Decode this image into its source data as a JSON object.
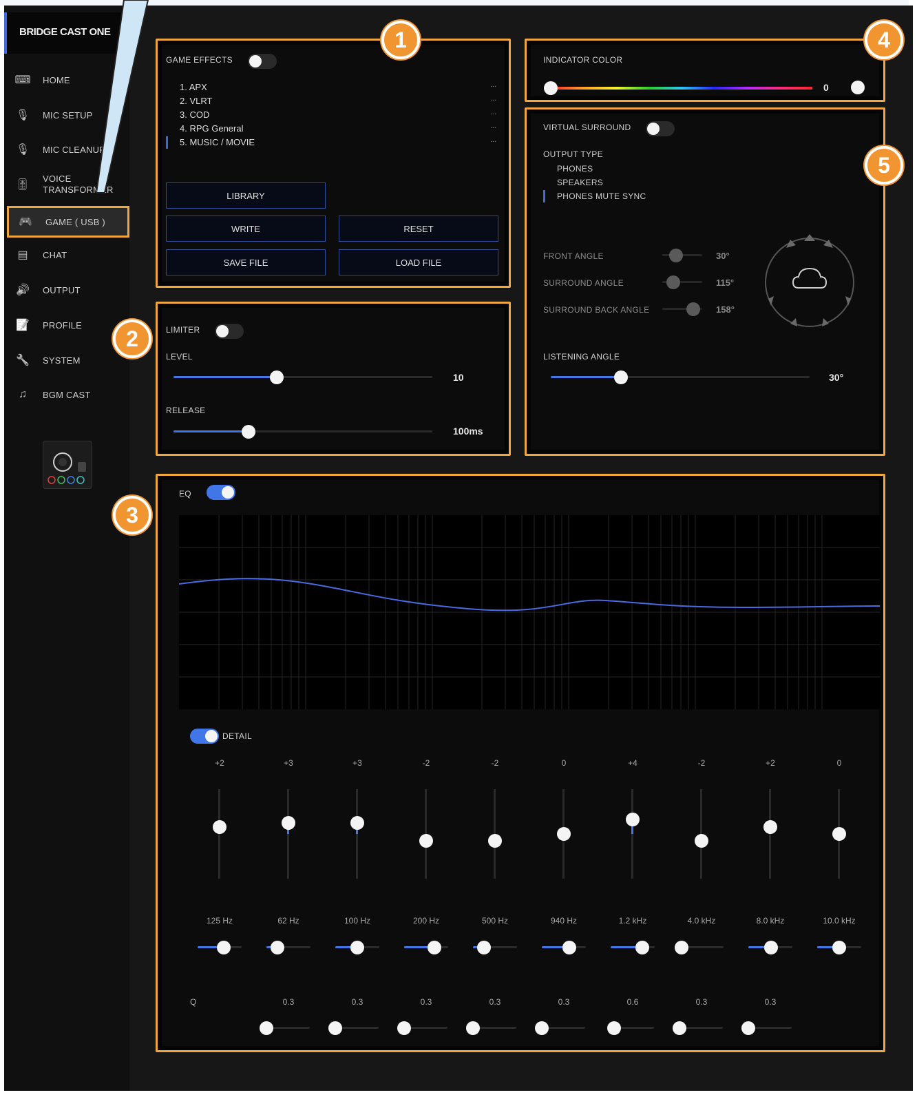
{
  "app": {
    "title": "BRIDGE CAST ONE"
  },
  "sidebar": {
    "items": [
      {
        "label": "HOME",
        "icon": "keyboard-icon"
      },
      {
        "label": "MIC SETUP",
        "icon": "mic-setup-icon"
      },
      {
        "label": "MIC CLEANUP",
        "icon": "mic-cleanup-icon"
      },
      {
        "label": "VOICE",
        "label2": "TRANSFORMER",
        "icon": "voice-transformer-icon"
      },
      {
        "label": "GAME ( USB )",
        "icon": "gamepad-icon",
        "active": true
      },
      {
        "label": "CHAT",
        "icon": "chat-icon"
      },
      {
        "label": "OUTPUT",
        "icon": "speaker-icon"
      },
      {
        "label": "PROFILE",
        "icon": "profile-icon"
      },
      {
        "label": "SYSTEM",
        "icon": "wrench-icon"
      },
      {
        "label": "BGM CAST",
        "icon": "music-icon"
      }
    ]
  },
  "callouts": [
    "1",
    "2",
    "3",
    "4",
    "5"
  ],
  "game_effects": {
    "label": "GAME EFFECTS",
    "enabled": false,
    "presets": [
      {
        "name": "1. APX",
        "more": "..."
      },
      {
        "name": "2. VLRT",
        "more": "..."
      },
      {
        "name": "3. COD",
        "more": "..."
      },
      {
        "name": "4. RPG General",
        "more": "..."
      },
      {
        "name": "5. MUSIC / MOVIE",
        "more": "...",
        "selected": true
      }
    ],
    "buttons": {
      "library": "LIBRARY",
      "write": "WRITE",
      "reset": "RESET",
      "save": "SAVE FILE",
      "load": "LOAD FILE"
    }
  },
  "limiter": {
    "label": "LIMITER",
    "enabled": false,
    "level": {
      "label": "LEVEL",
      "value": "10",
      "fraction": 0.4
    },
    "release": {
      "label": "RELEASE",
      "value": "100ms",
      "fraction": 0.29
    }
  },
  "indicator": {
    "label": "INDICATOR COLOR",
    "value": "0",
    "fraction": 0.0
  },
  "surround": {
    "label": "VIRTUAL SURROUND",
    "enabled": false,
    "output_type_label": "OUTPUT TYPE",
    "output_types": [
      "PHONES",
      "SPEAKERS",
      "PHONES MUTE SYNC"
    ],
    "selected_output": "PHONES MUTE SYNC",
    "angles": [
      {
        "label": "FRONT ANGLE",
        "value": "30°",
        "fraction": 0.35
      },
      {
        "label": "SURROUND ANGLE",
        "value": "115°",
        "fraction": 0.28
      },
      {
        "label": "SURROUND BACK ANGLE",
        "value": "158°",
        "fraction": 0.78
      }
    ],
    "listening": {
      "label": "LISTENING ANGLE",
      "value": "30°",
      "fraction": 0.27
    },
    "diagram_icon": "surround-diagram-icon"
  },
  "eq": {
    "label": "EQ",
    "enabled": true,
    "detail_label": "DETAIL",
    "detail_enabled": true,
    "q_label": "Q",
    "bands": [
      {
        "gain": "+2",
        "freq": "125 Hz",
        "gain_fraction": 0.58,
        "freq_fraction": 0.6,
        "q": "",
        "q_fraction": null
      },
      {
        "gain": "+3",
        "freq": "62 Hz",
        "gain_fraction": 0.62,
        "freq_fraction": 0.25,
        "q": "0.3",
        "q_fraction": 0.05
      },
      {
        "gain": "+3",
        "freq": "100 Hz",
        "gain_fraction": 0.62,
        "freq_fraction": 0.5,
        "q": "0.3",
        "q_fraction": 0.05
      },
      {
        "gain": "-2",
        "freq": "200 Hz",
        "gain_fraction": 0.42,
        "freq_fraction": 0.68,
        "q": "0.3",
        "q_fraction": 0.05
      },
      {
        "gain": "-2",
        "freq": "500 Hz",
        "gain_fraction": 0.42,
        "freq_fraction": 0.25,
        "q": "0.3",
        "q_fraction": 0.05
      },
      {
        "gain": "0",
        "freq": "940 Hz",
        "gain_fraction": 0.5,
        "freq_fraction": 0.62,
        "q": "0.3",
        "q_fraction": 0.05
      },
      {
        "gain": "+4",
        "freq": "1.2 kHz",
        "gain_fraction": 0.66,
        "freq_fraction": 0.72,
        "q": "0.6",
        "q_fraction": 0.12
      },
      {
        "gain": "-2",
        "freq": "4.0 kHz",
        "gain_fraction": 0.42,
        "freq_fraction": 0.05,
        "q": "0.3",
        "q_fraction": 0.05
      },
      {
        "gain": "+2",
        "freq": "8.0 kHz",
        "gain_fraction": 0.58,
        "freq_fraction": 0.52,
        "q": "0.3",
        "q_fraction": 0.05
      },
      {
        "gain": "0",
        "freq": "10.0 kHz",
        "gain_fraction": 0.5,
        "freq_fraction": 0.5,
        "q": "",
        "q_fraction": null
      }
    ]
  },
  "colors": {
    "accent": "#4176e8",
    "highlight": "#f0a742",
    "badge": "#f19530"
  }
}
